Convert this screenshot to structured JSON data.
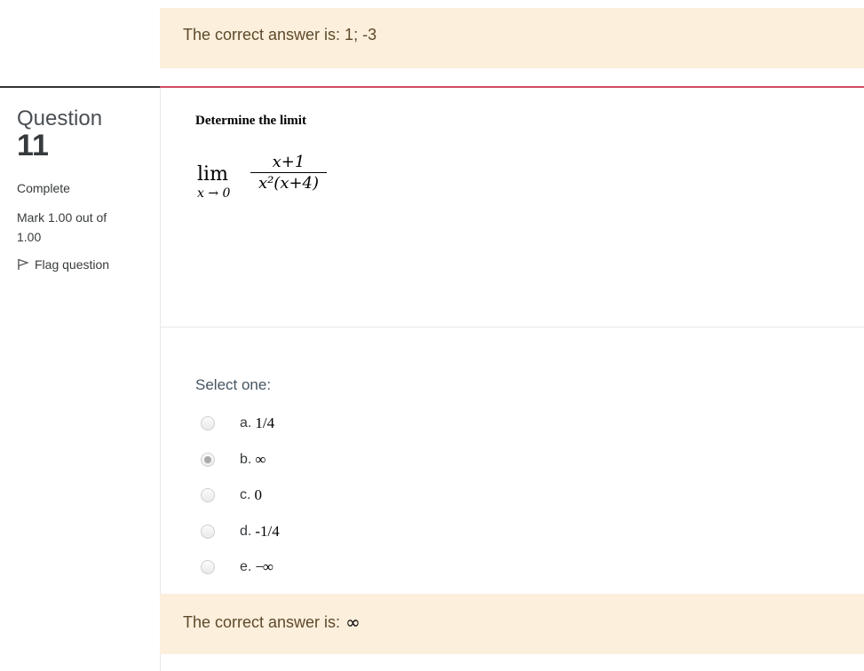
{
  "top_feedback": {
    "text": "The correct answer is: 1; -3"
  },
  "question_info": {
    "label": "Question",
    "number": "11",
    "state": "Complete",
    "grade": "Mark 1.00 out of 1.00",
    "flag_label": "Flag question"
  },
  "question": {
    "text": "Determine the limit",
    "math": {
      "lim": "lim",
      "sub": "x → 0",
      "numerator": "x+1",
      "denominator": "x²(x+4)"
    },
    "prompt": "Select one:",
    "options": [
      {
        "letter": "a.",
        "value": "1/4",
        "checked": false
      },
      {
        "letter": "b.",
        "value": "∞",
        "checked": true
      },
      {
        "letter": "c.",
        "value": "0",
        "checked": false
      },
      {
        "letter": "d.",
        "value": "-1/4",
        "checked": false
      },
      {
        "letter": "e.",
        "value": "−∞",
        "checked": false
      }
    ]
  },
  "bottom_feedback": {
    "text": "The correct answer is:",
    "answer": "∞"
  }
}
